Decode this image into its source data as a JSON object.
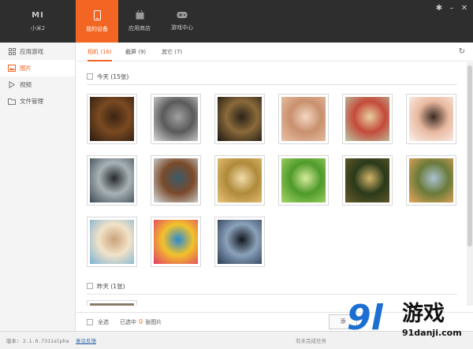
{
  "topbar": {
    "device": {
      "logo": "MI",
      "label": "小米2"
    },
    "tabs": [
      {
        "label": "我的设备",
        "icon": "phone-icon"
      },
      {
        "label": "应用商店",
        "icon": "bag-icon"
      },
      {
        "label": "游戏中心",
        "icon": "gamepad-icon"
      }
    ],
    "window_controls": [
      "settings-icon",
      "minimize-icon",
      "close-icon"
    ]
  },
  "sidebar": {
    "items": [
      {
        "label": "应用游戏",
        "icon": "apps-grid-icon",
        "active": false
      },
      {
        "label": "图片",
        "icon": "image-icon",
        "active": true
      },
      {
        "label": "视频",
        "icon": "play-icon",
        "active": false
      },
      {
        "label": "文件管理",
        "icon": "folder-icon",
        "active": false
      }
    ]
  },
  "subtabs": [
    {
      "label": "相机 (16)",
      "active": true
    },
    {
      "label": "截屏 (9)",
      "active": false
    },
    {
      "label": "其它 (7)",
      "active": false
    }
  ],
  "groups": [
    {
      "title": "今天 (15张)"
    },
    {
      "title": "昨天 (1张)"
    }
  ],
  "photos": [
    {
      "name": "dark-portrait",
      "colors": [
        "#2a1a10",
        "#7a4a22",
        "#3b2412"
      ]
    },
    {
      "name": "boots-bw",
      "colors": [
        "#d8d8d8",
        "#5a5a5a",
        "#a0a0a0"
      ]
    },
    {
      "name": "smoking-man",
      "colors": [
        "#1a1510",
        "#8a6a3a",
        "#2b2418"
      ]
    },
    {
      "name": "eye-closeup",
      "colors": [
        "#e9c3a8",
        "#c9906e",
        "#f2d8c2"
      ]
    },
    {
      "name": "child-playing",
      "colors": [
        "#b9c9a8",
        "#c44a3a",
        "#e8d0a0"
      ]
    },
    {
      "name": "baby-face",
      "colors": [
        "#fbf2ec",
        "#e9b9a0",
        "#3a2a22"
      ]
    },
    {
      "name": "dog-at-window",
      "colors": [
        "#3e4a52",
        "#a8b2b6",
        "#252a2e"
      ]
    },
    {
      "name": "bear-waterfall",
      "colors": [
        "#d6dde0",
        "#7a4a2a",
        "#3c5a6a"
      ]
    },
    {
      "name": "golden-hills",
      "colors": [
        "#e8c47a",
        "#b08a3a",
        "#f1dca8"
      ]
    },
    {
      "name": "green-hills",
      "colors": [
        "#a9d56a",
        "#4e9a2a",
        "#d8ec9c"
      ]
    },
    {
      "name": "forest-light",
      "colors": [
        "#6a5a2a",
        "#2a3a1a",
        "#d4b46a"
      ]
    },
    {
      "name": "sunset-field",
      "colors": [
        "#e9a65a",
        "#6a7a3a",
        "#aac3d2"
      ]
    },
    {
      "name": "puppy",
      "colors": [
        "#7ab2d4",
        "#f2e2c8",
        "#c9a27a"
      ]
    },
    {
      "name": "hot-air-balloon",
      "colors": [
        "#e23a6a",
        "#f2c22a",
        "#2a8ad2"
      ]
    },
    {
      "name": "city-harbor",
      "colors": [
        "#2a3a52",
        "#8aa2ba",
        "#12161e"
      ]
    }
  ],
  "bottombar": {
    "select_all": "全选",
    "selected_prefix": "已选中",
    "selected_count": "0",
    "selected_suffix": "张图片",
    "add_button": "添"
  },
  "statusbar": {
    "version": "版本: 2.1.0.7311alpha",
    "feedback": "意见反馈",
    "tasks": "有未完成任务"
  },
  "watermark": {
    "logo": "9l",
    "text": "游戏",
    "url": "91danji.com"
  },
  "colors": {
    "accent": "#f26522",
    "topbar": "#2e2e2e",
    "sidebar": "#f4f4f4"
  }
}
